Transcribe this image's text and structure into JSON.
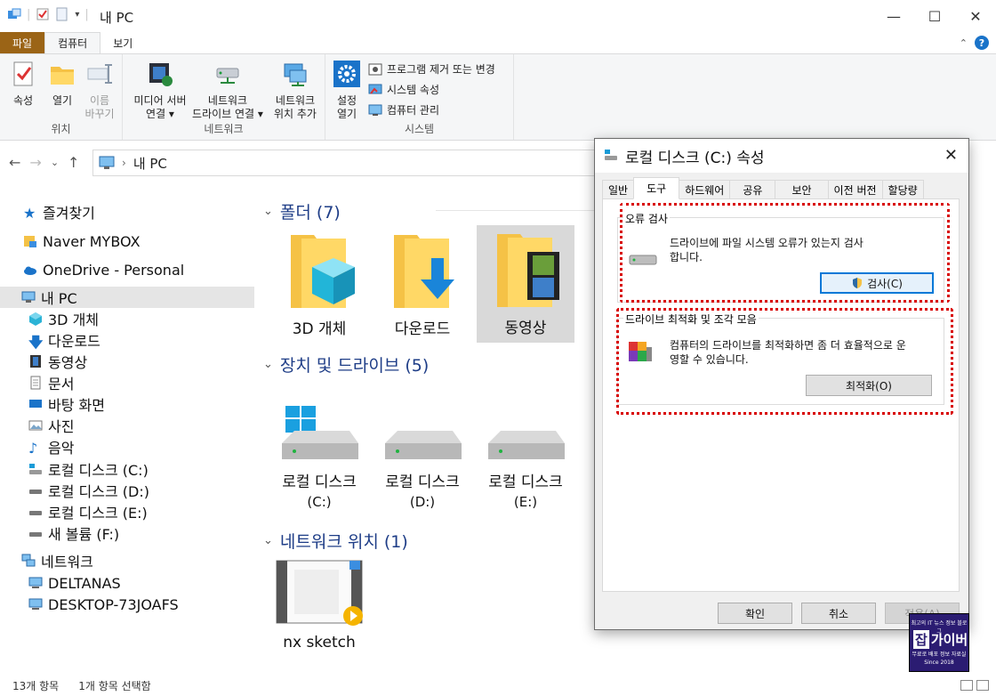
{
  "window": {
    "title": "내 PC"
  },
  "ribbon": {
    "tabs": [
      "파일",
      "컴퓨터",
      "보기"
    ],
    "location_group": {
      "label": "위치",
      "buttons": [
        {
          "line1": "속성",
          "line2": ""
        },
        {
          "line1": "열기",
          "line2": ""
        },
        {
          "line1": "이름",
          "line2": "바꾸기"
        }
      ]
    },
    "network_group": {
      "label": "네트워크",
      "buttons": [
        {
          "line1": "미디어 서버",
          "line2": "연결 ▾"
        },
        {
          "line1": "네트워크",
          "line2": "드라이브 연결 ▾"
        },
        {
          "line1": "네트워크",
          "line2": "위치 추가"
        }
      ]
    },
    "system_group": {
      "label": "시스템",
      "open_settings": {
        "line1": "설정",
        "line2": "열기"
      },
      "items": [
        "프로그램 제거 또는 변경",
        "시스템 속성",
        "컴퓨터 관리"
      ]
    }
  },
  "address": {
    "path": "내 PC"
  },
  "sidebar": {
    "items": [
      {
        "label": "즐겨찾기"
      },
      {
        "label": "Naver MYBOX"
      },
      {
        "label": "OneDrive - Personal"
      },
      {
        "label": "내 PC"
      },
      {
        "label": "3D 개체"
      },
      {
        "label": "다운로드"
      },
      {
        "label": "동영상"
      },
      {
        "label": "문서"
      },
      {
        "label": "바탕 화면"
      },
      {
        "label": "사진"
      },
      {
        "label": "음악"
      },
      {
        "label": "로컬 디스크 (C:)"
      },
      {
        "label": "로컬 디스크 (D:)"
      },
      {
        "label": "로컬 디스크 (E:)"
      },
      {
        "label": "새 볼륨 (F:)"
      },
      {
        "label": "네트워크"
      },
      {
        "label": "DELTANAS"
      },
      {
        "label": "DESKTOP-73JOAFS"
      }
    ]
  },
  "content": {
    "folders_header": "폴더 (7)",
    "folders": [
      {
        "label": "3D 개체"
      },
      {
        "label": "다운로드"
      },
      {
        "label": "동영상"
      }
    ],
    "drives_header": "장치 및 드라이브 (5)",
    "drives": [
      {
        "line1": "로컬 디스크",
        "line2": "(C:)"
      },
      {
        "line1": "로컬 디스크",
        "line2": "(D:)"
      },
      {
        "line1": "로컬 디스크",
        "line2": "(E:)"
      }
    ],
    "network_header": "네트워크 위치 (1)",
    "network": [
      {
        "label": "nx sketch"
      }
    ]
  },
  "statusbar": {
    "count": "13개 항목",
    "selected": "1개 항목 선택함"
  },
  "dialog": {
    "title": "로컬 디스크 (C:) 속성",
    "tabs": [
      "일반",
      "도구",
      "하드웨어",
      "공유",
      "보안",
      "이전 버전",
      "할당량"
    ],
    "error_check": {
      "title": "오류 검사",
      "text1": "드라이브에 파일 시스템 오류가 있는지 검사",
      "text2": "합니다.",
      "button": "검사(C)"
    },
    "optimize": {
      "title": "드라이브 최적화 및 조각 모음",
      "text1": "컴퓨터의 드라이브를 최적화하면 좀 더 효율적으로 운",
      "text2": "영할 수 있습니다.",
      "button": "최적화(O)"
    },
    "buttons": {
      "ok": "확인",
      "cancel": "취소",
      "apply": "적용(A)"
    }
  },
  "watermark": {
    "line1": "최고의 IT 뉴스 정보 블로그",
    "brand": "가이버",
    "badge": "잡",
    "line3": "무료로 배포 정보 자료실",
    "line4": "Since 2018"
  },
  "colors": {
    "accent": "#0078d7",
    "file_tab": "#9b6416",
    "section_header": "#1e3d87",
    "highlight": "#d80000"
  }
}
